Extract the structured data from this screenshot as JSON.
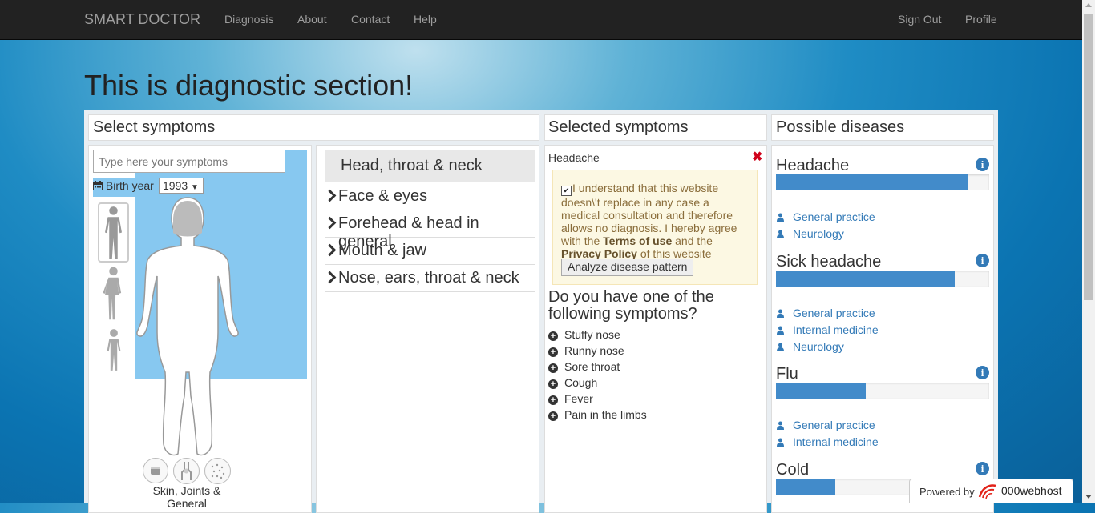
{
  "navbar": {
    "brand": "SMART DOCTOR",
    "links": [
      "Diagnosis",
      "About",
      "Contact",
      "Help"
    ],
    "right_links": [
      "Sign Out",
      "Profile"
    ]
  },
  "page_title": "This is diagnostic section!",
  "select_panel": {
    "title": "Select symptoms",
    "search_placeholder": "Type here your symptoms",
    "birth_label": "Birth year",
    "birth_year": "1993",
    "category_label": "Skin, Joints & General"
  },
  "body_regions": {
    "active": "Head, throat & neck",
    "items": [
      "Face & eyes",
      "Forehead & head in general",
      "Mouth & jaw",
      "Nose, ears, throat & neck"
    ]
  },
  "selected_panel": {
    "title": "Selected symptoms",
    "symptom": "Headache",
    "disclaimer_before": "I understand that this website doesn\\'t replace in any case a medical consultation and therefore allows no diagnosis. I hereby agree with the ",
    "terms_link": "Terms of use",
    "disclaimer_middle": " and the ",
    "privacy_link": "Privacy Policy",
    "disclaimer_after": " of this website",
    "analyze_button": "Analyze disease pattern",
    "question": "Do you have one of the following symptoms?",
    "suggestions": [
      "Stuffy nose",
      "Runny nose",
      "Sore throat",
      "Cough",
      "Fever",
      "Pain in the limbs"
    ]
  },
  "diseases_panel": {
    "title": "Possible diseases",
    "diseases": [
      {
        "name": "Headache",
        "likelihood": 0.9,
        "specialties": [
          "General practice",
          "Neurology"
        ]
      },
      {
        "name": "Sick headache",
        "likelihood": 0.84,
        "specialties": [
          "General practice",
          "Internal medicine",
          "Neurology"
        ]
      },
      {
        "name": "Flu",
        "likelihood": 0.42,
        "specialties": [
          "General practice",
          "Internal medicine"
        ]
      },
      {
        "name": "Cold",
        "likelihood": 0.28,
        "specialties": []
      }
    ]
  },
  "footer_badge": {
    "powered": "Powered by",
    "host": "000webhost"
  },
  "colors": {
    "navbar": "#222222",
    "progress": "#428bca",
    "link": "#337ab7",
    "body_area": "#87c8f0",
    "warning_bg": "#fcf8e3"
  }
}
